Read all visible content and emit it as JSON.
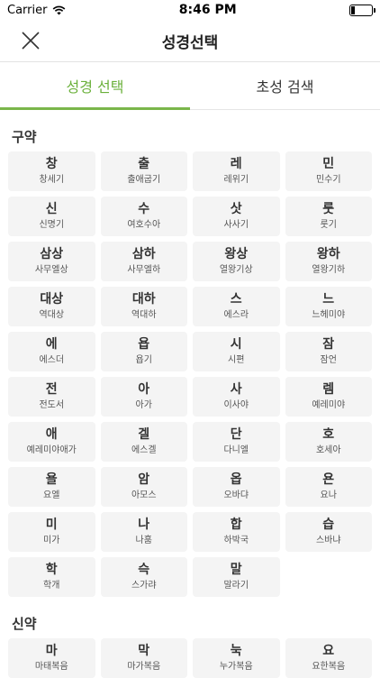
{
  "status": {
    "carrier": "Carrier",
    "time": "8:46 PM",
    "battery_level": 0.15
  },
  "navbar": {
    "title": "성경선택"
  },
  "tabs": [
    {
      "label": "성경 선택",
      "active": true
    },
    {
      "label": "초성 검색",
      "active": false
    }
  ],
  "old_testament": {
    "title": "구약",
    "books": [
      {
        "abbr": "창",
        "name": "창세기"
      },
      {
        "abbr": "출",
        "name": "출애굽기"
      },
      {
        "abbr": "레",
        "name": "레위기"
      },
      {
        "abbr": "민",
        "name": "민수기"
      },
      {
        "abbr": "신",
        "name": "신명기"
      },
      {
        "abbr": "수",
        "name": "여호수아"
      },
      {
        "abbr": "삿",
        "name": "사사기"
      },
      {
        "abbr": "룻",
        "name": "룻기"
      },
      {
        "abbr": "삼상",
        "name": "사무엘상"
      },
      {
        "abbr": "삼하",
        "name": "사무엘하"
      },
      {
        "abbr": "왕상",
        "name": "열왕기상"
      },
      {
        "abbr": "왕하",
        "name": "열왕기하"
      },
      {
        "abbr": "대상",
        "name": "역대상"
      },
      {
        "abbr": "대하",
        "name": "역대하"
      },
      {
        "abbr": "스",
        "name": "에스라"
      },
      {
        "abbr": "느",
        "name": "느헤미야"
      },
      {
        "abbr": "에",
        "name": "에스더"
      },
      {
        "abbr": "욥",
        "name": "욥기"
      },
      {
        "abbr": "시",
        "name": "시편"
      },
      {
        "abbr": "잠",
        "name": "잠언"
      },
      {
        "abbr": "전",
        "name": "전도서"
      },
      {
        "abbr": "아",
        "name": "아가"
      },
      {
        "abbr": "사",
        "name": "이사야"
      },
      {
        "abbr": "렘",
        "name": "예레미야"
      },
      {
        "abbr": "애",
        "name": "예레미야애가"
      },
      {
        "abbr": "겔",
        "name": "에스겔"
      },
      {
        "abbr": "단",
        "name": "다니엘"
      },
      {
        "abbr": "호",
        "name": "호세아"
      },
      {
        "abbr": "욜",
        "name": "요엘"
      },
      {
        "abbr": "암",
        "name": "아모스"
      },
      {
        "abbr": "옵",
        "name": "오바댜"
      },
      {
        "abbr": "욘",
        "name": "요나"
      },
      {
        "abbr": "미",
        "name": "미가"
      },
      {
        "abbr": "나",
        "name": "나훔"
      },
      {
        "abbr": "합",
        "name": "하박국"
      },
      {
        "abbr": "습",
        "name": "스바냐"
      },
      {
        "abbr": "학",
        "name": "학개"
      },
      {
        "abbr": "슥",
        "name": "스가랴"
      },
      {
        "abbr": "말",
        "name": "말라기"
      }
    ]
  },
  "new_testament": {
    "title": "신약",
    "books": [
      {
        "abbr": "마",
        "name": "마태복음"
      },
      {
        "abbr": "막",
        "name": "마가복음"
      },
      {
        "abbr": "눅",
        "name": "누가복음"
      },
      {
        "abbr": "요",
        "name": "요한복음"
      }
    ]
  },
  "colors": {
    "accent": "#7ab64a",
    "cell_bg": "#f4f4f4"
  }
}
